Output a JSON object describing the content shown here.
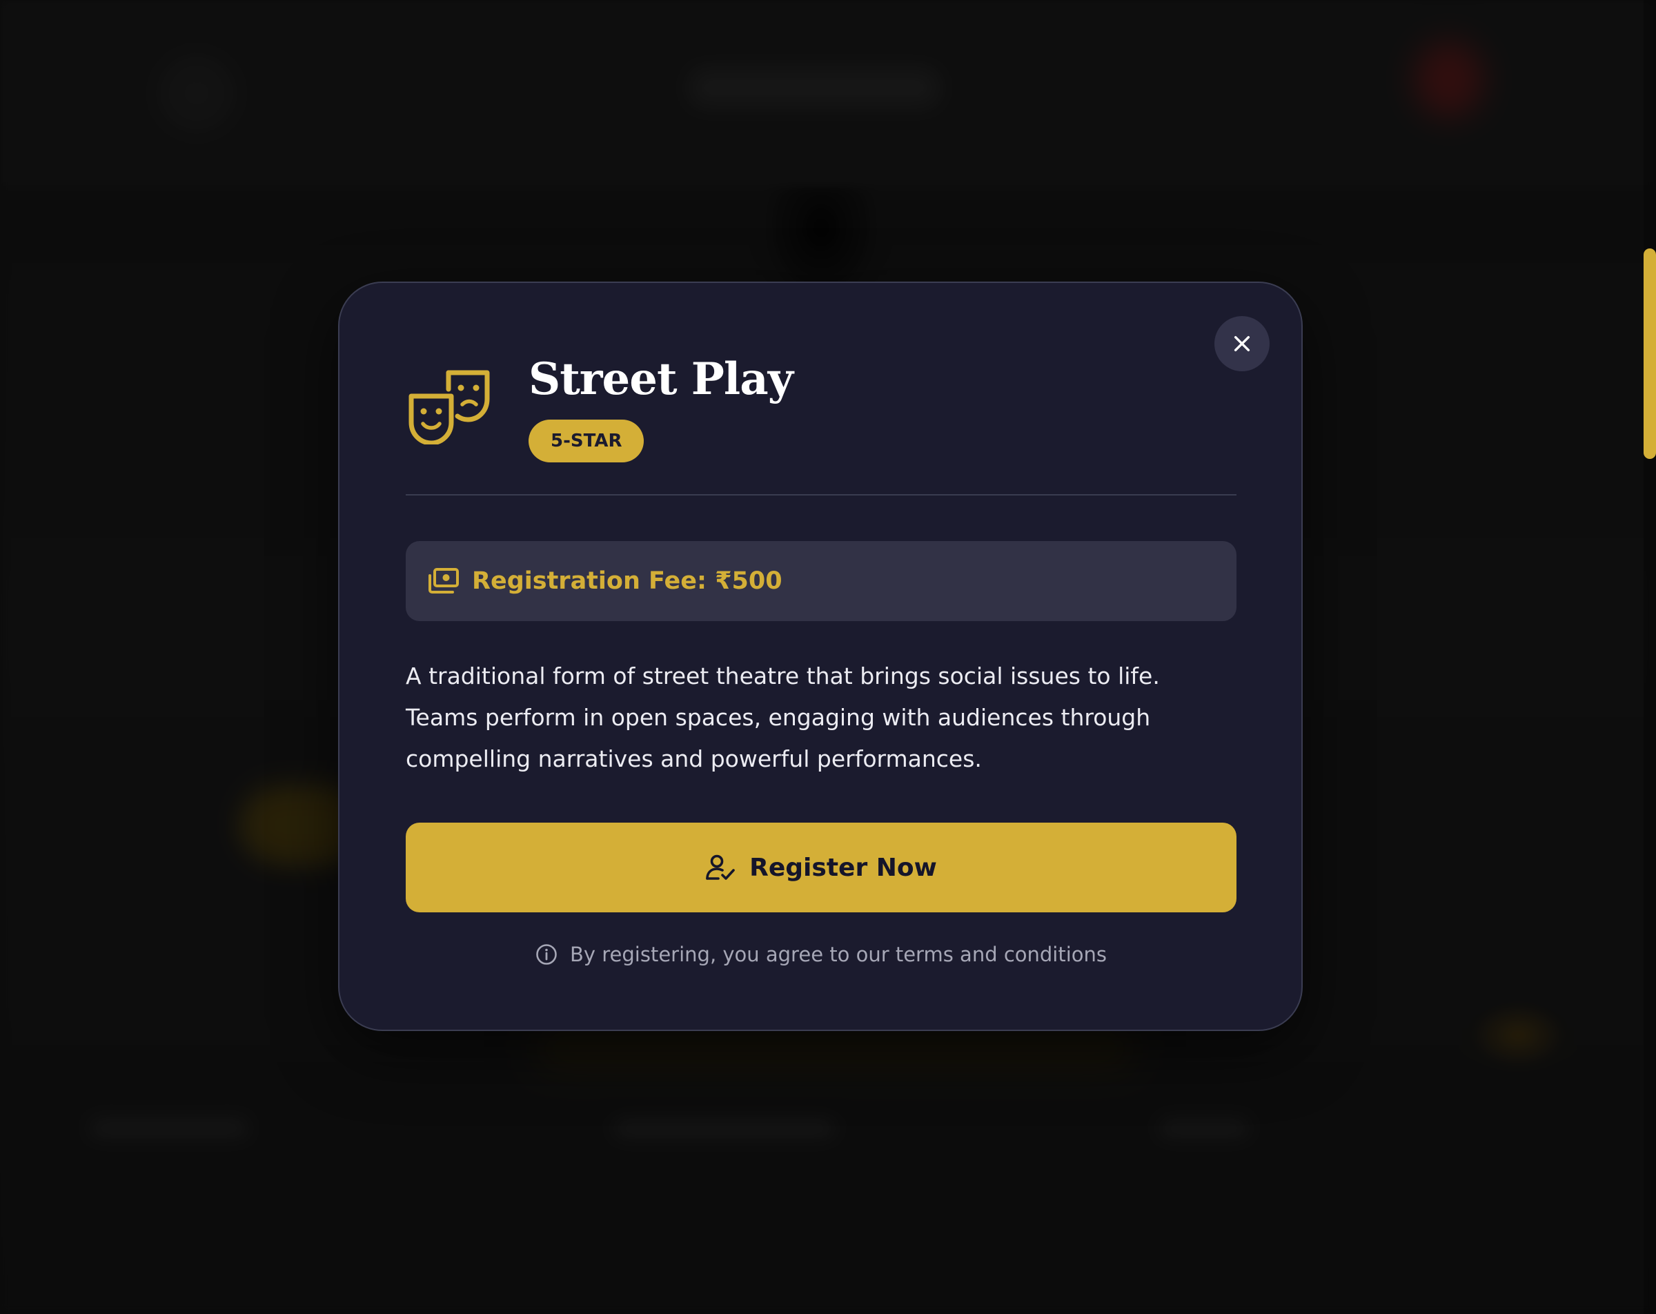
{
  "modal": {
    "title": "Street Play",
    "badge": "5-STAR",
    "fee_text": "Registration Fee: ₹500",
    "description": "A traditional form of street theatre that brings social issues to life. Teams perform in open spaces, engaging with audiences through compelling narratives and powerful performances.",
    "register_label": "Register Now",
    "terms_text": "By registering, you agree to our terms and conditions"
  },
  "icons": {
    "header": "theater-masks-icon",
    "close": "close-icon",
    "fee": "money-icon",
    "register": "user-check-icon",
    "info": "info-icon"
  },
  "colors": {
    "accent": "#d4af37",
    "modal_background": "#1b1b2e",
    "fee_box_background": "#323246",
    "close_button_background": "#33334a"
  }
}
